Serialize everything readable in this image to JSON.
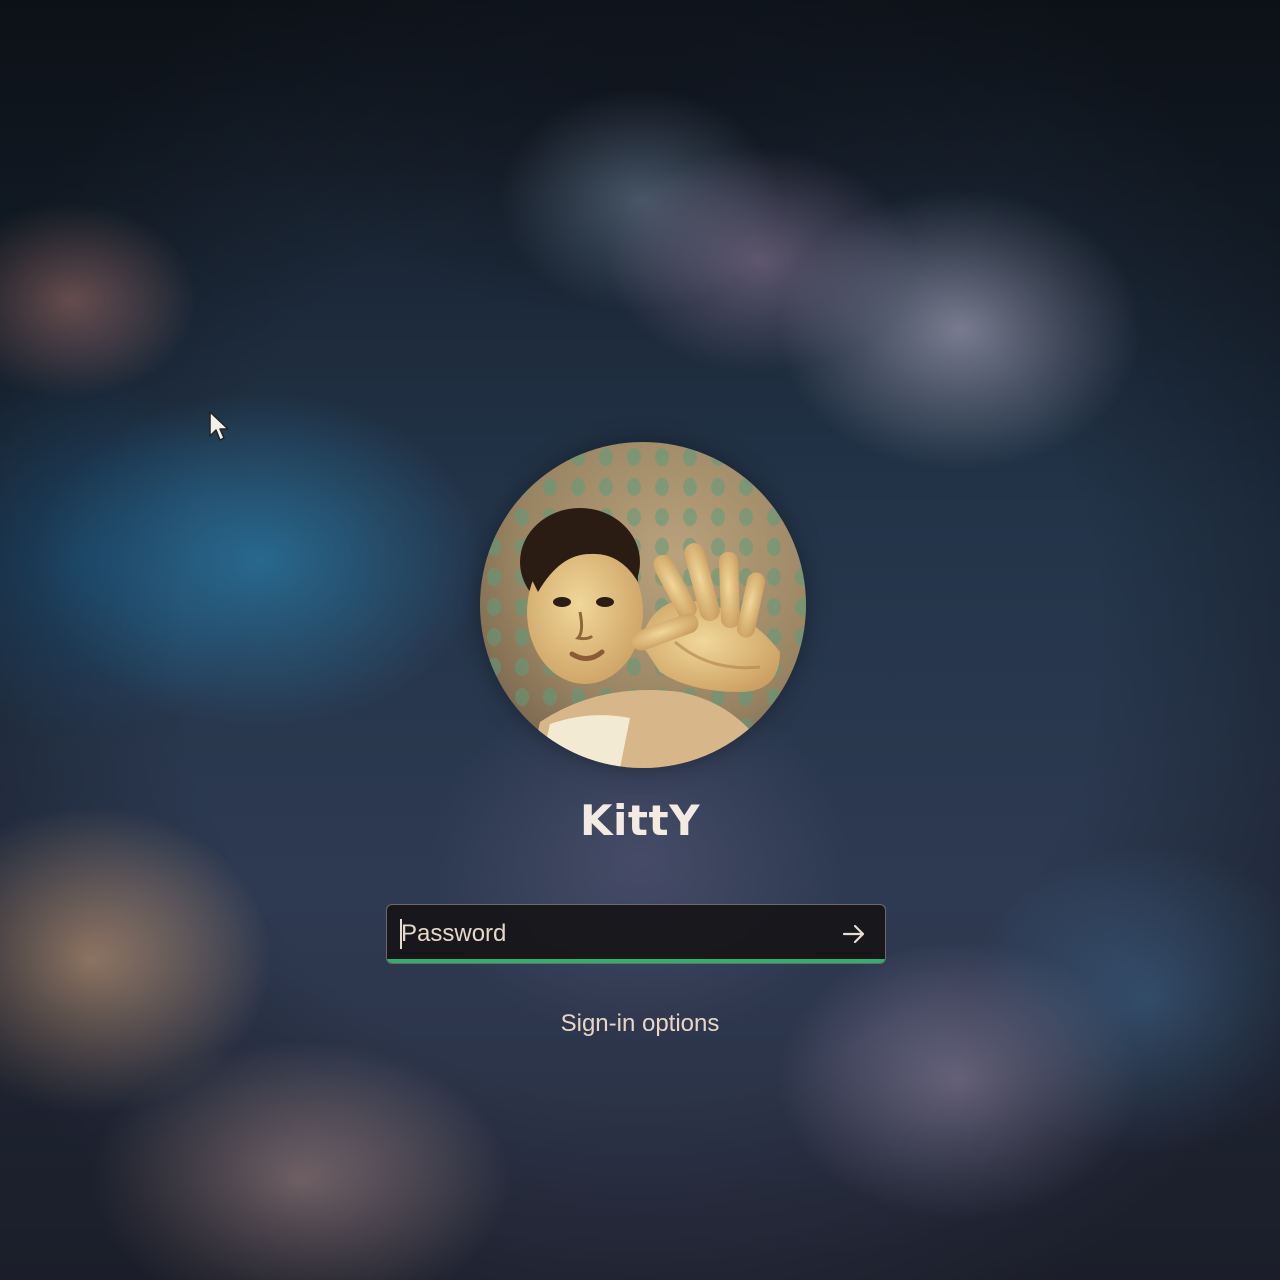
{
  "user": {
    "name": "KittY"
  },
  "password": {
    "placeholder": "Password",
    "value": ""
  },
  "signin": {
    "options_label": "Sign-in options"
  },
  "colors": {
    "focus_underline": "#2fb06b",
    "text": "#f3ebe2"
  },
  "icons": {
    "cursor": "mouse-pointer-icon",
    "submit": "arrow-right-icon"
  }
}
